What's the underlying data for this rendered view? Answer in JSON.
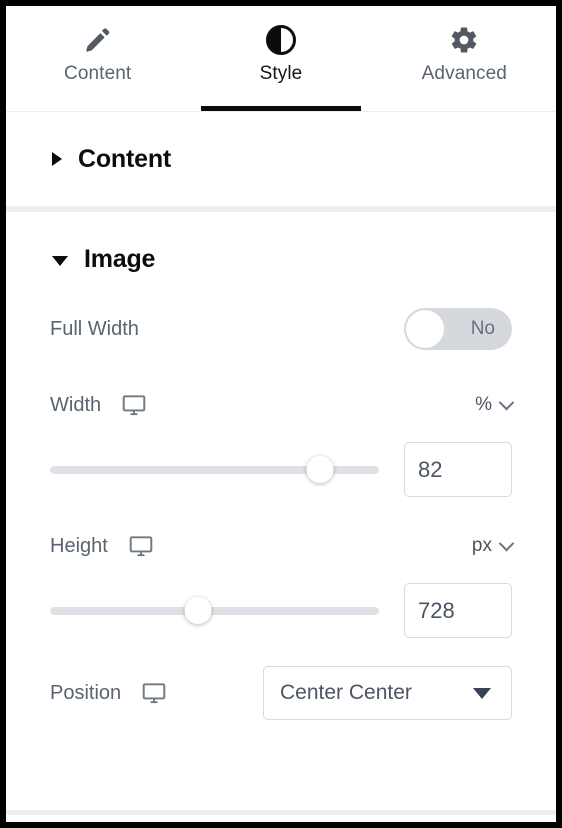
{
  "panel": {
    "tabs": [
      {
        "label": "Content",
        "icon": "pencil-icon",
        "active": false
      },
      {
        "label": "Style",
        "icon": "contrast-icon",
        "active": true
      },
      {
        "label": "Advanced",
        "icon": "gear-icon",
        "active": false
      }
    ],
    "sections": [
      {
        "title": "Content",
        "expanded": false,
        "icon": "triangle-right-icon"
      },
      {
        "title": "Image",
        "expanded": true,
        "icon": "triangle-down-icon"
      }
    ],
    "controls": {
      "full_width": {
        "label": "Full Width",
        "toggle_value": "No",
        "toggle_on": false
      },
      "width": {
        "label": "Width",
        "device_icon": "desktop-monitor-icon",
        "unit": "%",
        "unit_caret": "chevron-down-icon",
        "value": "82",
        "slider_percent": 82
      },
      "height": {
        "label": "Height",
        "device_icon": "desktop-monitor-icon",
        "unit": "px",
        "unit_caret": "chevron-down-icon",
        "value": "728",
        "slider_percent": 45
      },
      "position": {
        "label": "Position",
        "device_icon": "desktop-monitor-icon",
        "value": "Center Center",
        "caret": "caret-down-icon"
      }
    }
  },
  "colors": {
    "accent": "#0c0c0c",
    "label_text": "#5a6470",
    "value_text": "#4b5563",
    "track": "#dfe1e6",
    "toggle_off": "#d5d8dd",
    "divider": "#eceef0",
    "border": "#d7dae0"
  }
}
